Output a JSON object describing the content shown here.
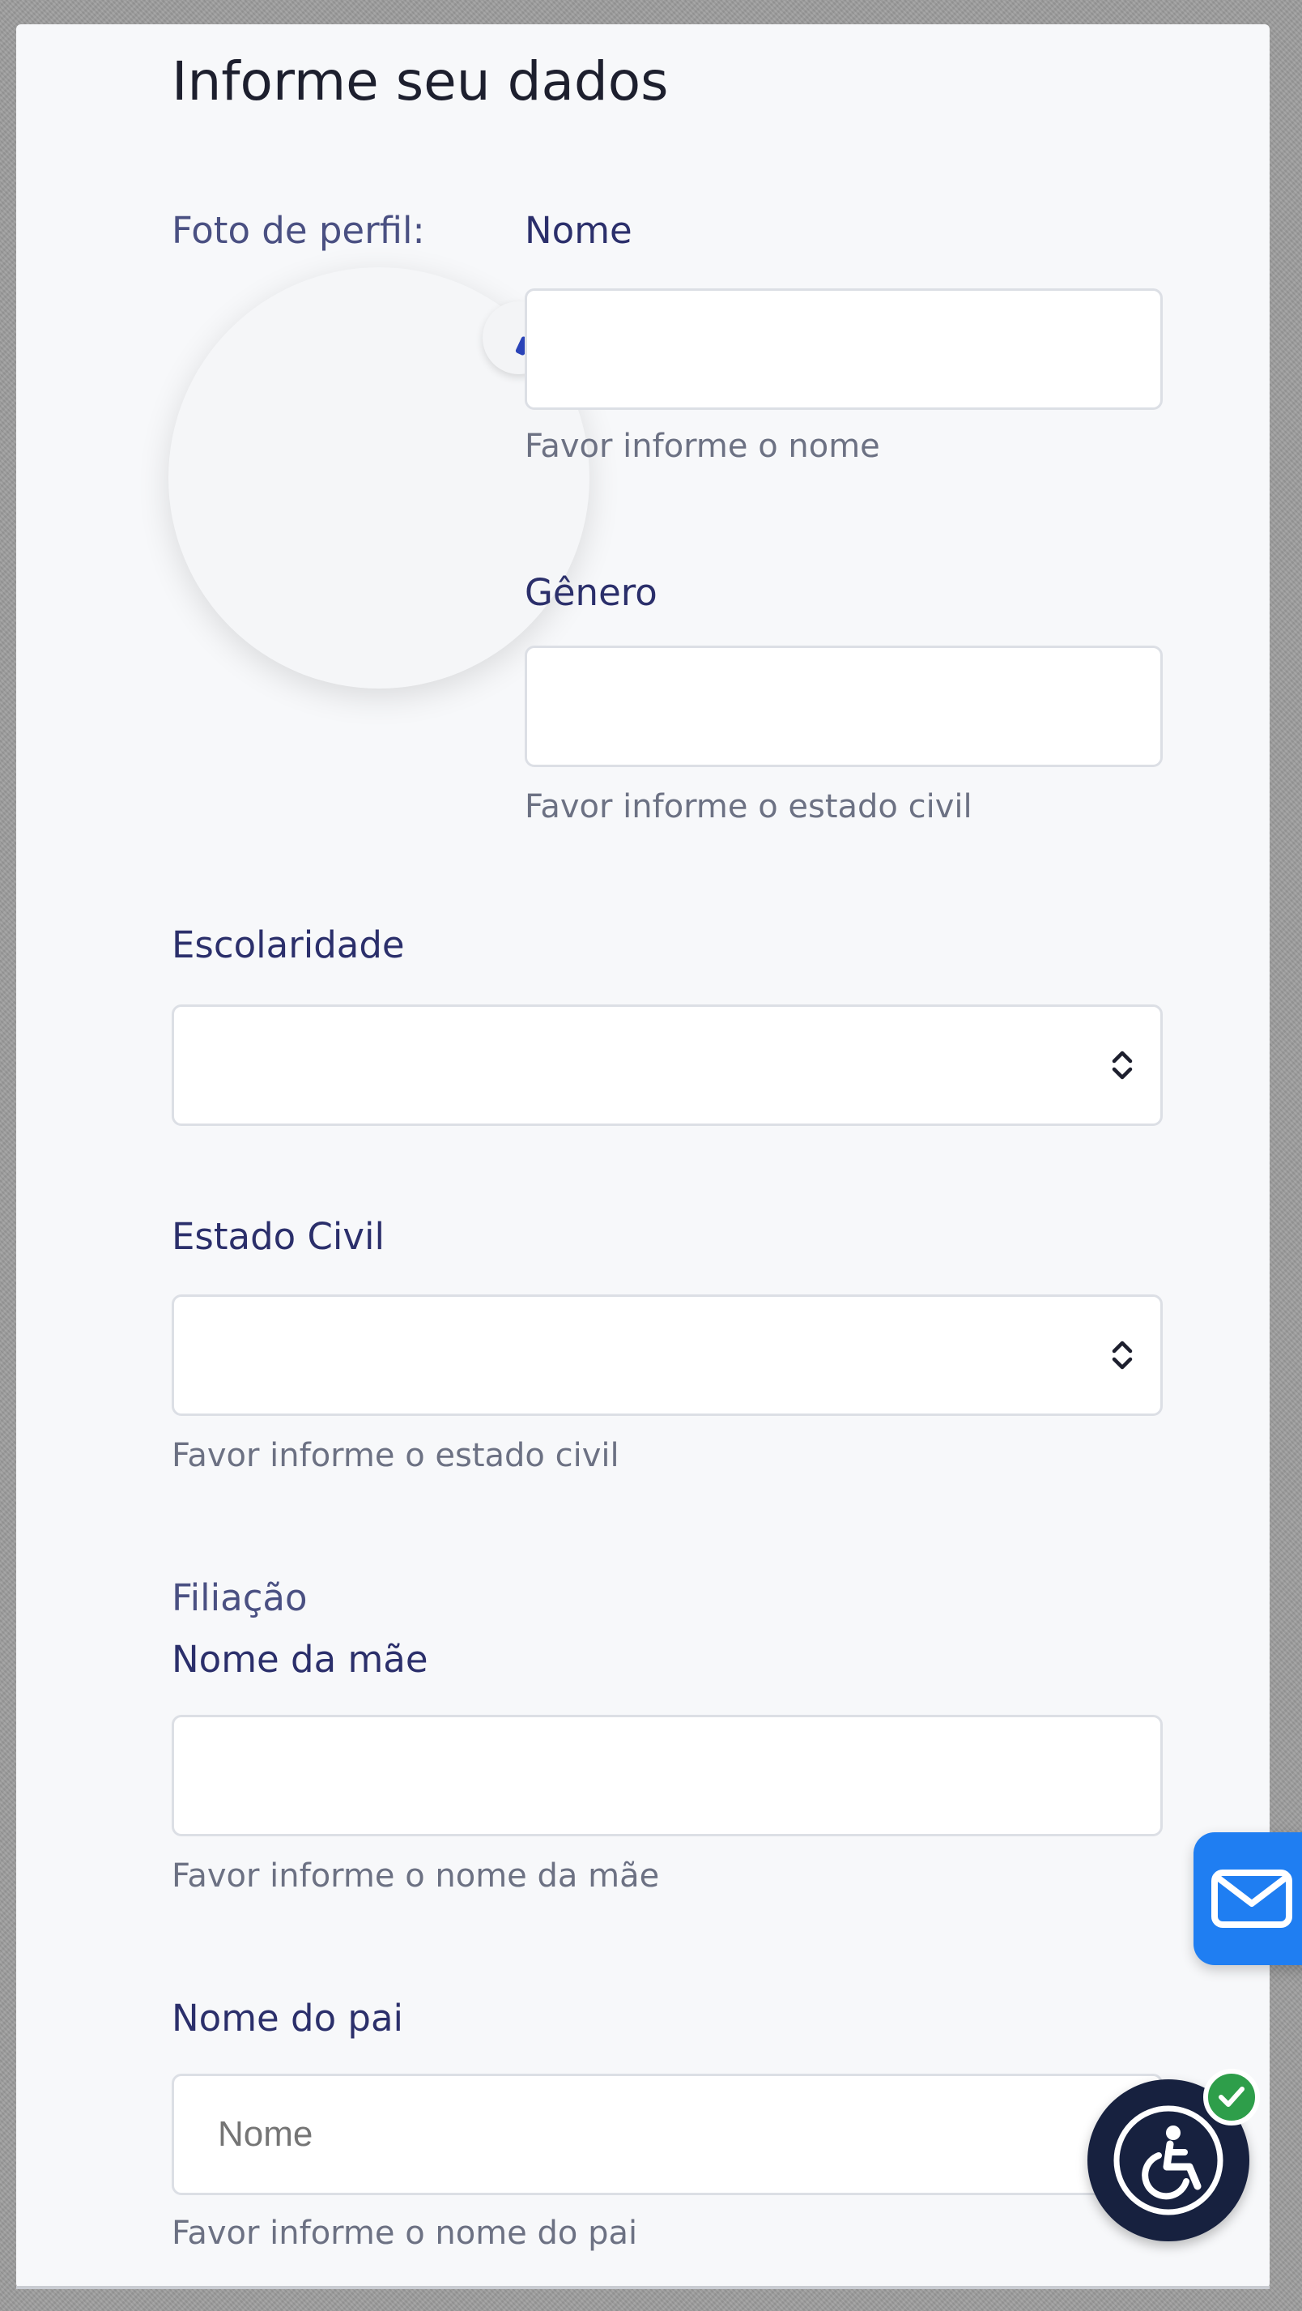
{
  "page_title": "Informe seu dados",
  "profile_photo_label": "Foto de perfil:",
  "fields": {
    "nome": {
      "label": "Nome",
      "value": "",
      "hint": "Favor informe o nome"
    },
    "genero": {
      "label": "Gênero",
      "value": "",
      "hint": "Favor informe o estado civil"
    },
    "escolaridade": {
      "label": "Escolaridade",
      "value": ""
    },
    "estado_civil": {
      "label": "Estado Civil",
      "value": "",
      "hint": "Favor informe o estado civil"
    },
    "filiacao": {
      "section_label": "Filiação"
    },
    "nome_mae": {
      "label": "Nome da mãe",
      "value": "",
      "hint": "Favor informe o nome da mãe"
    },
    "nome_pai": {
      "label": "Nome do pai",
      "placeholder": "Nome",
      "hint": "Favor informe o nome do pai"
    }
  },
  "icons": {
    "avatar_edit": "pencil-icon",
    "select_arrow": "chevron-updown-icon",
    "mail": "mail-icon",
    "accessibility": "wheelchair-icon",
    "status": "check-icon"
  },
  "colors": {
    "accent": "#1f7ef2",
    "label": "#2b2f6b",
    "hint": "#6c7183",
    "accessibility_bg": "#17213f",
    "status_green": "#2e9e4a"
  }
}
